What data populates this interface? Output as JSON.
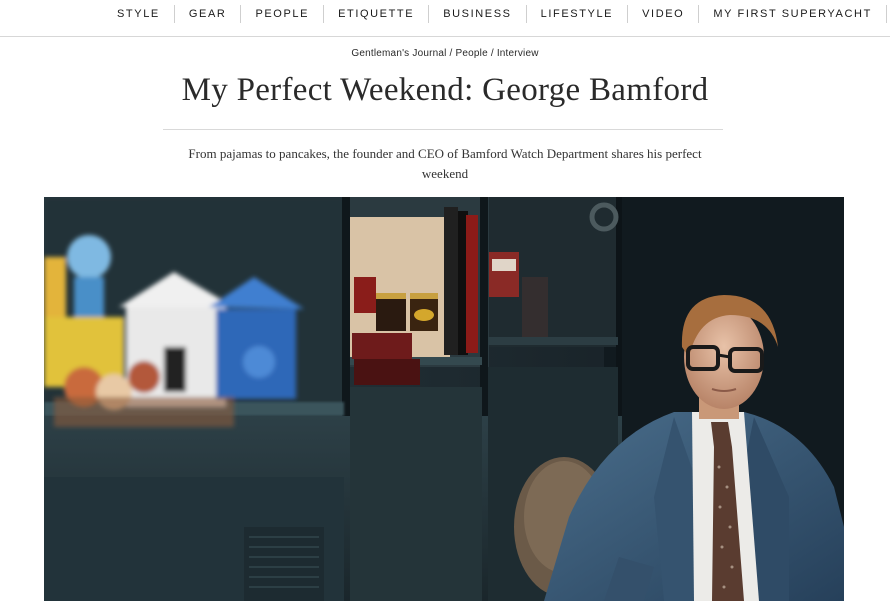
{
  "nav": {
    "items": [
      "STYLE",
      "GEAR",
      "PEOPLE",
      "ETIQUETTE",
      "BUSINESS",
      "LIFESTYLE",
      "VIDEO",
      "MY FIRST SUPERYACHT"
    ]
  },
  "breadcrumb": {
    "items": [
      "Gentleman's Journal",
      "People",
      "Interview"
    ],
    "separator": "/"
  },
  "article": {
    "title": "My Perfect Weekend: George Bamford",
    "dek": "From pajamas to pancakes, the founder and CEO of Bamford Watch Department shares his perfect weekend"
  },
  "hero_image": {
    "alt_description": "photo"
  },
  "colors": {
    "text": "#2a2a2a",
    "rule": "#d9d9d9",
    "hero_bg": "#1b272d"
  }
}
